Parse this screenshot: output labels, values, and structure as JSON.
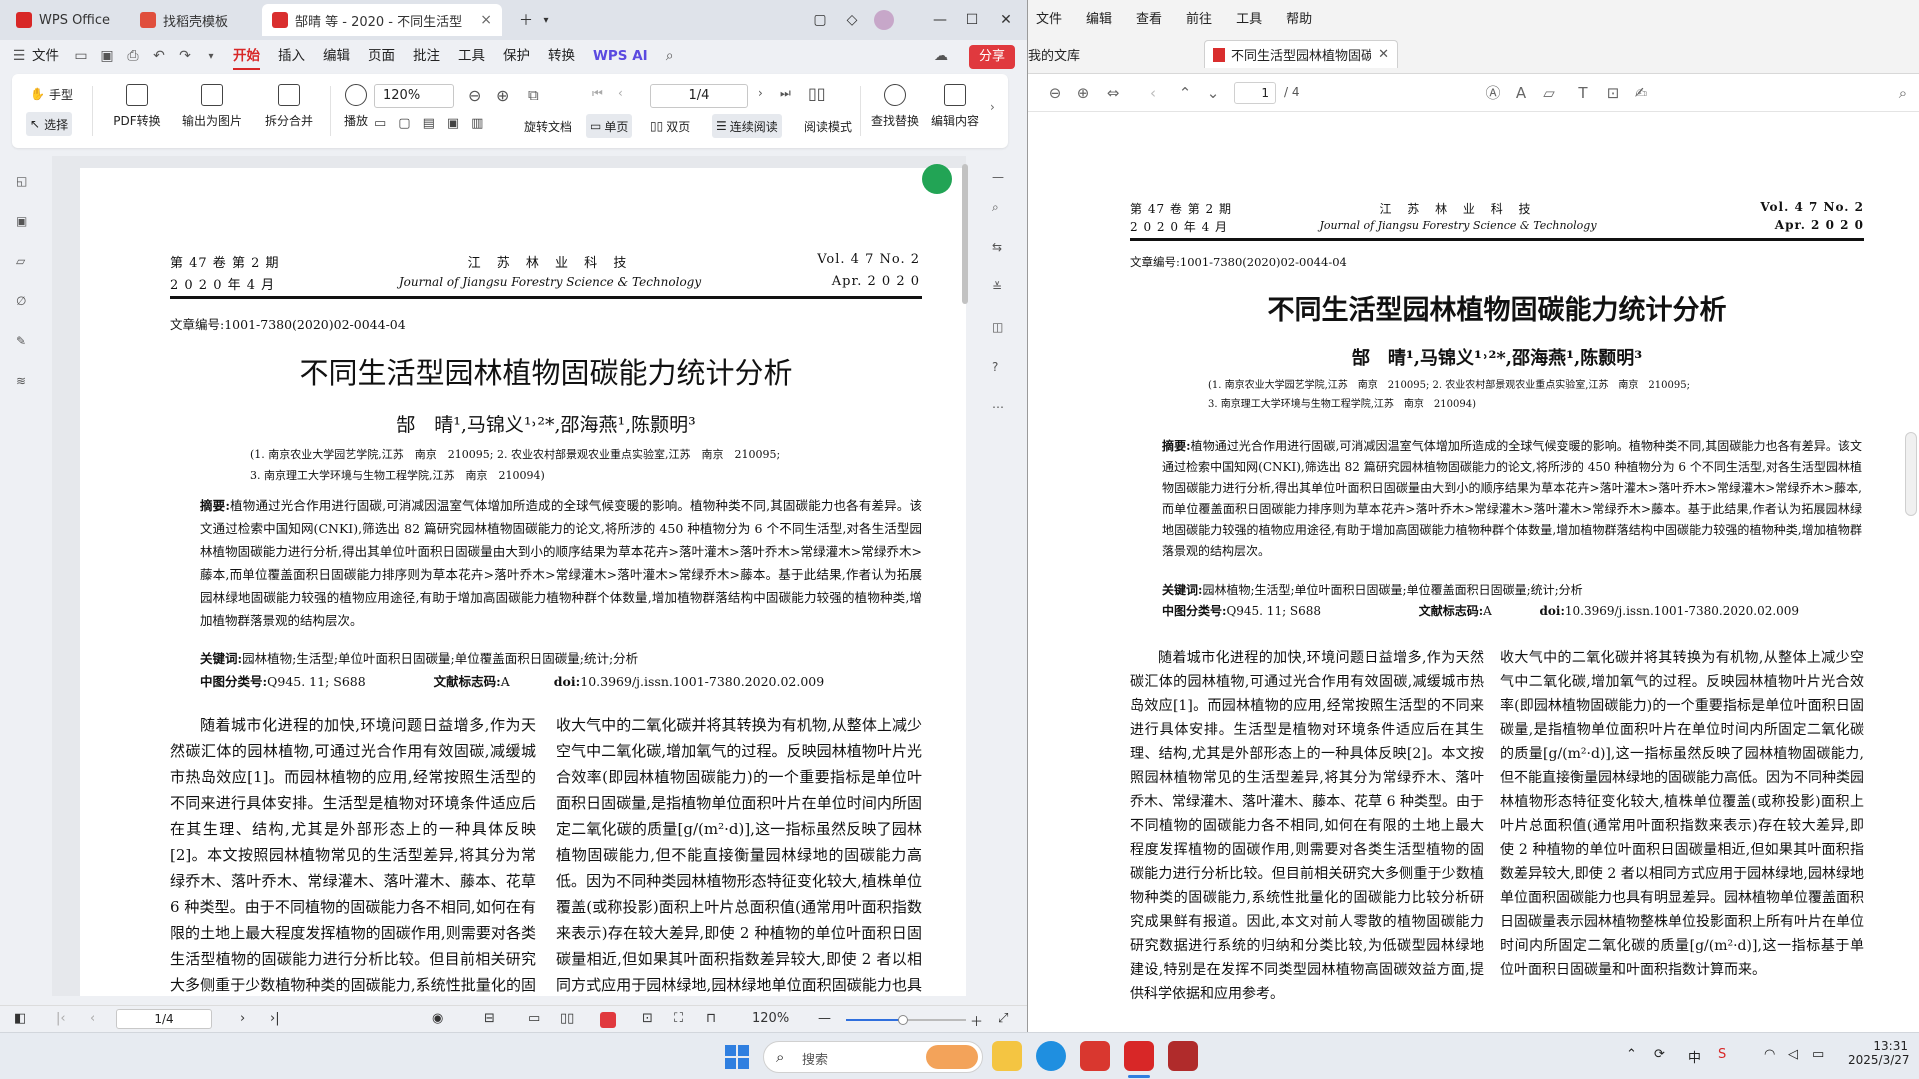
{
  "wps": {
    "tabs": [
      {
        "label": "WPS Office"
      },
      {
        "label": "找稻壳模板"
      },
      {
        "label": "郜晴 等 - 2020 - 不同生活型"
      }
    ],
    "menu": [
      "文件",
      "开始",
      "插入",
      "编辑",
      "页面",
      "批注",
      "工具",
      "保护",
      "转换"
    ],
    "wps_ai": "WPS AI",
    "share": "分享",
    "ribbon": {
      "hand": "手型",
      "select": "选择",
      "pdf_convert": "PDF转换",
      "export_image": "输出为图片",
      "split_merge": "拆分合并",
      "play": "播放",
      "zoom": "120%",
      "page": "1/4",
      "rotate": "旋转文档",
      "single": "单页",
      "double": "双页",
      "continuous": "连续阅读",
      "read_mode": "阅读模式",
      "find_replace": "查找替换",
      "edit_content": "编辑内容"
    },
    "status": {
      "page": "1/4",
      "zoom": "120%"
    }
  },
  "paper": {
    "vol_cn": "第 47 卷 第 2 期",
    "date_cn": "2 0 2 0 年 4 月",
    "journal_cn": "江 苏 林 业 科 技",
    "journal_en": "Journal of Jiangsu Forestry Science & Technology",
    "vol_en": "Vol. 4 7  No. 2",
    "date_en": "Apr.  2 0 2 0",
    "article_no": "文章编号:1001-7380(2020)02-0044-04",
    "title": "不同生活型园林植物固碳能力统计分析",
    "authors": "郜　晴¹,马锦义¹˒²*,邵海燕¹,陈颢明³",
    "aff1": "(1. 南京农业大学园艺学院,江苏　南京　210095; 2. 农业农村部景观农业重点实验室,江苏　南京　210095;",
    "aff2": "3. 南京理工大学环境与生物工程学院,江苏　南京　210094)",
    "abstract_label": "摘要:",
    "abstract": "植物通过光合作用进行固碳,可消减因温室气体增加所造成的全球气候变暖的影响。植物种类不同,其固碳能力也各有差异。该文通过检索中国知网(CNKI),筛选出 82 篇研究园林植物固碳能力的论文,将所涉的 450 种植物分为 6 个不同生活型,对各生活型园林植物固碳能力进行分析,得出其单位叶面积日固碳量由大到小的顺序结果为草本花卉>落叶灌木>落叶乔木>常绿灌木>常绿乔木>藤本,而单位覆盖面积日固碳能力排序则为草本花卉>落叶乔木>常绿灌木>落叶灌木>常绿乔木>藤本。基于此结果,作者认为拓展园林绿地固碳能力较强的植物应用途径,有助于增加高固碳能力植物种群个体数量,增加植物群落结构中固碳能力较强的植物种类,增加植物群落景观的结构层次。",
    "keywords_label": "关键词:",
    "keywords": "园林植物;生活型;单位叶面积日固碳量;单位覆盖面积日固碳量;统计;分析",
    "clc_label": "中图分类号:",
    "clc": "Q945. 11; S688",
    "doc_code_label": "文献标志码:",
    "doc_code": "A",
    "doi_label": "doi:",
    "doi": "10.3969/j.issn.1001-7380.2020.02.009",
    "col1": "随着城市化进程的加快,环境问题日益增多,作为天然碳汇体的园林植物,可通过光合作用有效固碳,减缓城市热岛效应[1]。而园林植物的应用,经常按照生活型的不同来进行具体安排。生活型是植物对环境条件适应后在其生理、结构,尤其是外部形态上的一种具体反映[2]。本文按照园林植物常见的生活型差异,将其分为常绿乔木、落叶乔木、常绿灌木、落叶灌木、藤本、花草 6 种类型。由于不同植物的固碳能力各不相同,如何在有限的土地上最大程度发挥植物的固碳作用,则需要对各类生活型植物的固碳能力进行分析比较。但目前相关研究大多侧重于少数植物种类的固碳能力,系统性批量化的固碳能力比较分析研究成果鲜有报道。因此,本文对前人零散的植物固碳能力研究数据进行系统的归纳和分类比较,为低碳型园林绿地建设,特别是在发挥不同类型园林植物高固碳效益方面,提供科学依据和应用参考。",
    "col2": "收大气中的二氧化碳并将其转换为有机物,从整体上减少空气中二氧化碳,增加氧气的过程。反映园林植物叶片光合效率(即园林植物固碳能力)的一个重要指标是单位叶面积日固碳量,是指植物单位面积叶片在单位时间内所固定二氧化碳的质量[g/(m²·d)],这一指标虽然反映了园林植物固碳能力,但不能直接衡量园林绿地的固碳能力高低。因为不同种类园林植物形态特征变化较大,植株单位覆盖(或称投影)面积上叶片总面积值(通常用叶面积指数来表示)存在较大差异,即使 2 种植物的单位叶面积日固碳量相近,但如果其叶面积指数差异较大,即使 2 者以相同方式应用于园林绿地,园林绿地单位面积固碳能力也具有明显差异。园林植物单位覆盖面积日固碳量表示园林植物整株单位投影面积上所有叶片在单位时间内所固定二氧化碳的质量[g/(m²·d)],这一指标基于单位叶面积日固碳量和叶面积指数计算而来。"
  },
  "rv": {
    "menu": [
      "文件",
      "编辑",
      "查看",
      "前往",
      "工具",
      "帮助"
    ],
    "library_tab": "我的文库",
    "doc_tab": "不同生活型园林植物固碳",
    "page_current": "1",
    "page_total": "/ 4"
  },
  "taskbar": {
    "search": "搜索",
    "ime": "中",
    "time": "13:31",
    "date": "2025/3/27"
  },
  "colors": {
    "wps_red": "#d82727",
    "share_bg": "#e0393e",
    "accent_blue": "#2f6fdd"
  }
}
